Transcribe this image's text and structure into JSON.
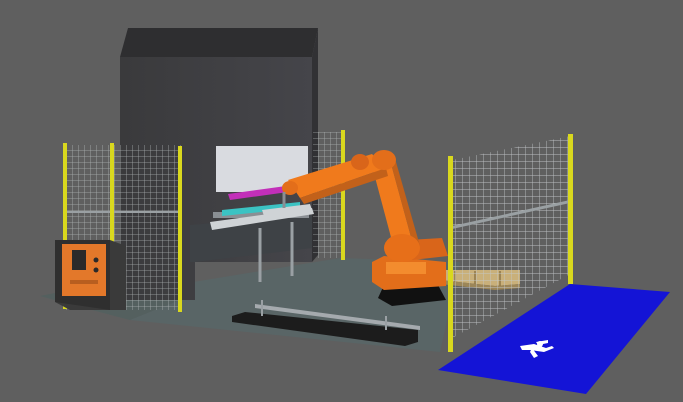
{
  "scene": {
    "background_color": "#5f5f5f",
    "floor_color": "#596566",
    "press_color": "#3c3c3e",
    "fence_color": "#d9d81e",
    "robot_color": "#f07a1c",
    "walkway_color": "#1414d6",
    "pallet_color": "#c9b07a",
    "laser_scanner_zone_icon": "person-walking-icon",
    "control_cabinet_color": "#3d3d3d",
    "panel_color": "#e3782a"
  }
}
